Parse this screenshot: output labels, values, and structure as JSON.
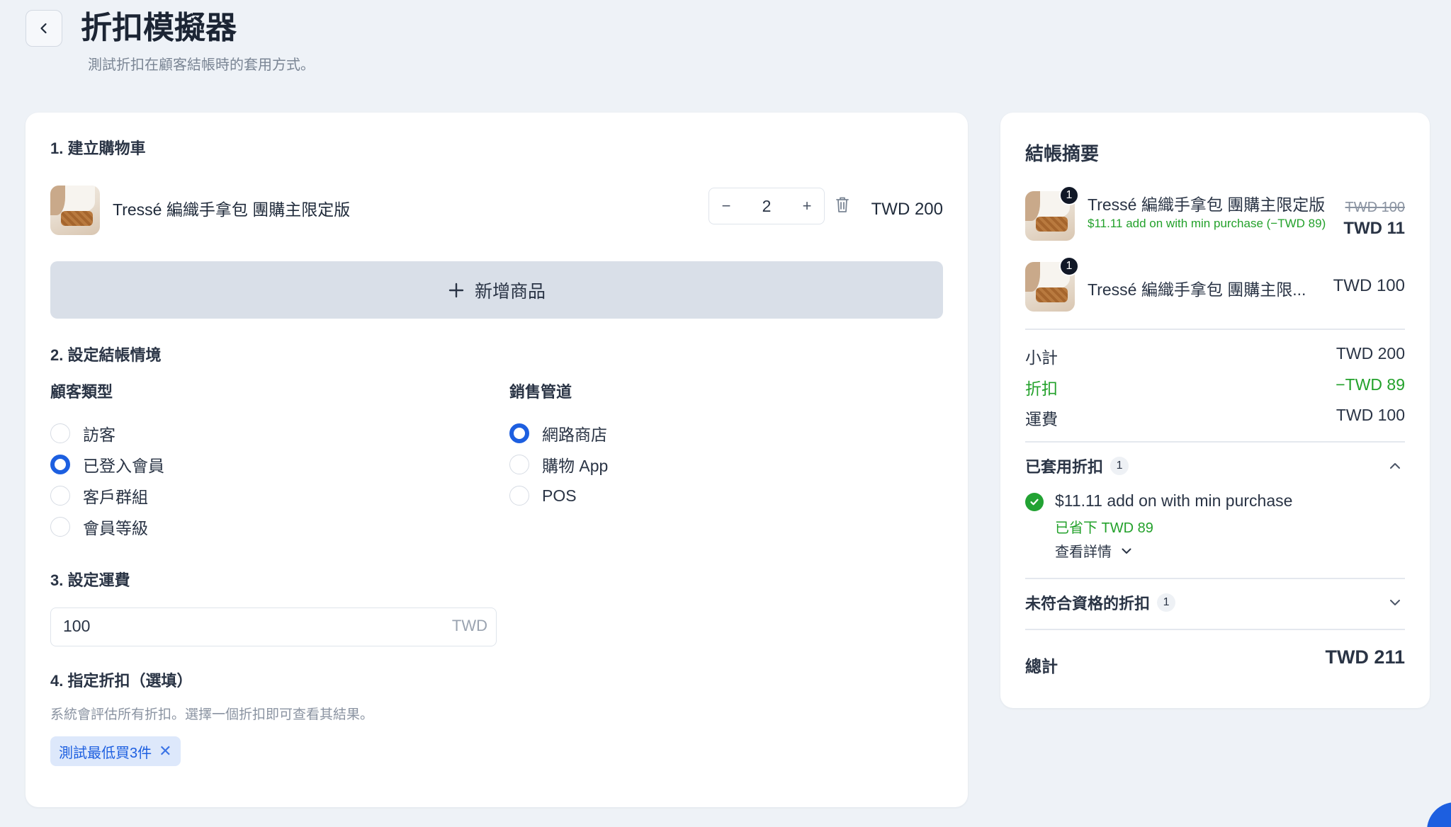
{
  "header": {
    "title": "折扣模擬器",
    "subtitle": "測試折扣在顧客結帳時的套用方式。"
  },
  "cart": {
    "section_title": "1. 建立購物車",
    "item": {
      "name": "Tressé 編織手拿包 團購主限定版",
      "quantity": "2",
      "price": "TWD 200",
      "image_icon": "product-thumbnail"
    },
    "qty_minus": "−",
    "qty_plus": "+",
    "add_button_label": "新增商品"
  },
  "scenario": {
    "section_title": "2. 設定結帳情境",
    "customer_type": {
      "label": "顧客類型",
      "options": [
        "訪客",
        "已登入會員",
        "客戶群組",
        "會員等級"
      ],
      "selected": "已登入會員"
    },
    "channel": {
      "label": "銷售管道",
      "options": [
        "網路商店",
        "購物 App",
        "POS"
      ],
      "selected": "網路商店"
    }
  },
  "shipping": {
    "section_title": "3. 設定運費",
    "value": "100",
    "unit": "TWD"
  },
  "discount_select": {
    "section_title": "4. 指定折扣（選填）",
    "hint": "系統會評估所有折扣。選擇一個折扣即可查看其結果。",
    "chip_label": "測試最低買3件",
    "chip_remove": "✕"
  },
  "summary": {
    "title": "結帳摘要",
    "items": [
      {
        "badge": "1",
        "name": "Tressé 編織手拿包 團購主限定版",
        "discount_note": "$11.11 add on with min purchase (−TWD 89)",
        "original_price": "TWD 100",
        "price": "TWD 11"
      },
      {
        "badge": "1",
        "name": "Tressé 編織手拿包 團購主限...",
        "price": "TWD 100"
      }
    ],
    "subtotal_label": "小計",
    "subtotal_value": "TWD 200",
    "discount_label": "折扣",
    "discount_value": "−TWD 89",
    "shipping_label": "運費",
    "shipping_value": "TWD 100",
    "applied": {
      "title": "已套用折扣",
      "count": "1",
      "discount_name": "$11.11 add on with min purchase",
      "saved": "已省下 TWD 89",
      "details_label": "查看詳情"
    },
    "ineligible": {
      "title": "未符合資格的折扣",
      "count": "1"
    },
    "total_label": "總計",
    "total_value": "TWD 211"
  },
  "colors": {
    "accent": "#1d5fe0",
    "success": "#23a12b",
    "background": "#eef2f7"
  }
}
